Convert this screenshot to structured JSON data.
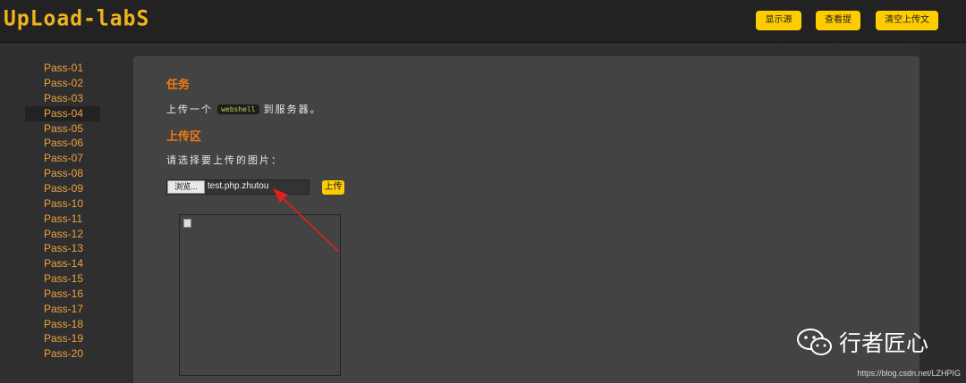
{
  "header": {
    "logo": "UpLoad-labS",
    "buttons": [
      {
        "label": "显示源码"
      },
      {
        "label": "查看提示"
      },
      {
        "label": "清空上传文件"
      }
    ]
  },
  "sidebar": {
    "items": [
      {
        "label": "Pass-01"
      },
      {
        "label": "Pass-02"
      },
      {
        "label": "Pass-03"
      },
      {
        "label": "Pass-04",
        "active": true
      },
      {
        "label": "Pass-05"
      },
      {
        "label": "Pass-06"
      },
      {
        "label": "Pass-07"
      },
      {
        "label": "Pass-08"
      },
      {
        "label": "Pass-09"
      },
      {
        "label": "Pass-10"
      },
      {
        "label": "Pass-11"
      },
      {
        "label": "Pass-12"
      },
      {
        "label": "Pass-13"
      },
      {
        "label": "Pass-14"
      },
      {
        "label": "Pass-15"
      },
      {
        "label": "Pass-16"
      },
      {
        "label": "Pass-17"
      },
      {
        "label": "Pass-18"
      },
      {
        "label": "Pass-19"
      },
      {
        "label": "Pass-20"
      }
    ]
  },
  "main": {
    "task_heading": "任务",
    "task_pre": "上传一个",
    "task_code": "webshell",
    "task_post": "到服务器。",
    "upload_heading": "上传区",
    "upload_prompt": "请选择要上传的图片：",
    "browse_label": "浏览...",
    "file_name": "test.php.zhutou",
    "upload_button": "上传"
  },
  "watermark": {
    "name": "行者匠心",
    "url": "https://blog.csdn.net/LZHPIG"
  },
  "colors": {
    "accent": "#ffcc00",
    "heading": "#f07a10",
    "sidebar_link": "#f0a040",
    "arrow": "#e02020"
  }
}
